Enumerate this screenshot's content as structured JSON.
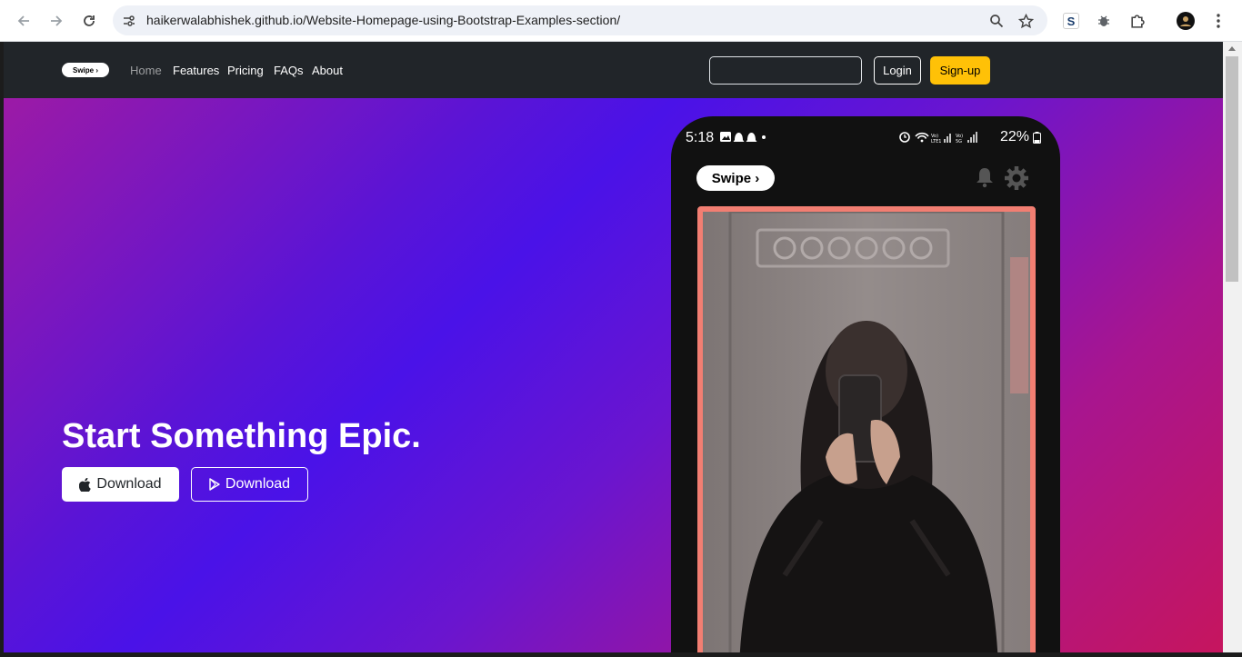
{
  "browser": {
    "url": "haikerwalabhishek.github.io/Website-Homepage-using-Bootstrap-Examples-section/",
    "extension_s_label": "S"
  },
  "site_nav": {
    "brand": "Swipe ›",
    "links": [
      "Home",
      "Features",
      "Pricing",
      "FAQs",
      "About"
    ],
    "search_placeholder": "",
    "login_label": "Login",
    "signup_label": "Sign-up"
  },
  "hero": {
    "title": "Start Something Epic.",
    "apple_download": "Download",
    "play_download": "Download"
  },
  "phone": {
    "status_time": "5:18",
    "status_battery": "22%",
    "app_logo": "Swipe ›"
  },
  "colors": {
    "nav_bg": "#212529",
    "signup_accent": "#ffc107",
    "photo_border": "#f27e72"
  }
}
